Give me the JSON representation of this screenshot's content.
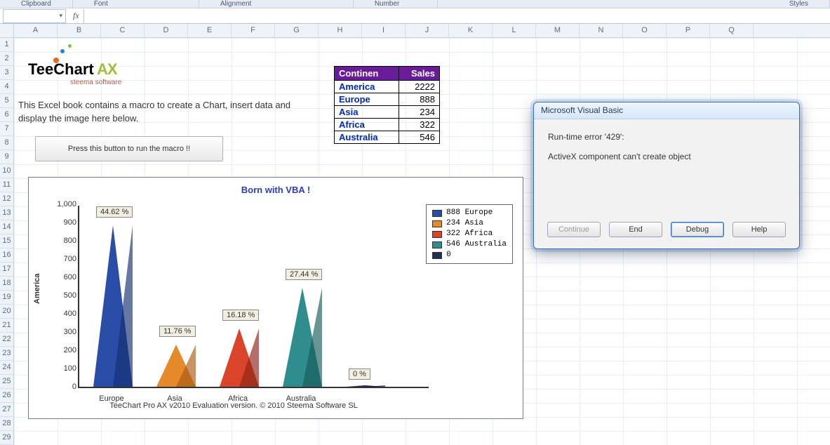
{
  "ribbon": {
    "groups": [
      "Clipboard",
      "Font",
      "Alignment",
      "Number",
      "Styles"
    ]
  },
  "nameBox": {
    "value": ""
  },
  "fxLabel": "fx",
  "formula": "",
  "columns": [
    "A",
    "B",
    "C",
    "D",
    "E",
    "F",
    "G",
    "H",
    "I",
    "J",
    "K",
    "L",
    "M",
    "N",
    "O",
    "P",
    "Q"
  ],
  "rowCount": 29,
  "logo": {
    "part1": "Tee",
    "part2": "Chart",
    "part3": " AX",
    "sub": "steema software"
  },
  "description": "This Excel book contains a macro to create a Chart, insert data and display the image here below.",
  "macroButton": "Press this button to run the macro !!",
  "table": {
    "headers": {
      "continent": "Continen",
      "sales": "Sales"
    },
    "rows": [
      {
        "region": "America",
        "value": "2222"
      },
      {
        "region": "Europe",
        "value": "888"
      },
      {
        "region": "Asia",
        "value": "234"
      },
      {
        "region": "Africa",
        "value": "322"
      },
      {
        "region": "Australia",
        "value": "546"
      }
    ]
  },
  "chart_data": {
    "type": "bar",
    "title": "Born with VBA !",
    "ylabel": "America",
    "ylim": [
      0,
      1000
    ],
    "yticks": [
      0,
      100,
      200,
      300,
      400,
      500,
      600,
      700,
      800,
      900,
      "1,000"
    ],
    "categories": [
      "Europe",
      "Asia",
      "Africa",
      "Australia",
      ""
    ],
    "series": [
      {
        "name": "888 Europe",
        "color": "#2a4da8"
      },
      {
        "name": "234 Asia",
        "color": "#e58a2a"
      },
      {
        "name": "322 Africa",
        "color": "#d9442a"
      },
      {
        "name": "546 Australia",
        "color": "#2f8d8d"
      },
      {
        "name": "0",
        "color": "#1e2e55"
      }
    ],
    "bars": [
      {
        "label": "Europe",
        "value": 888,
        "pct": "44.62 %",
        "color": "#2a4da8",
        "dark": "#14306e"
      },
      {
        "label": "Asia",
        "value": 234,
        "pct": "11.76 %",
        "color": "#e58a2a",
        "dark": "#a85a12"
      },
      {
        "label": "Africa",
        "value": 322,
        "pct": "16.18 %",
        "color": "#d9442a",
        "dark": "#8c2414"
      },
      {
        "label": "Australia",
        "value": 546,
        "pct": "27.44 %",
        "color": "#2f8d8d",
        "dark": "#185a5a"
      },
      {
        "label": "",
        "value": 0,
        "pct": "0 %",
        "color": "#1e2e55",
        "dark": "#0d1530"
      }
    ],
    "watermark": "TeeChart Pro AX v2010 Evaluation version. © 2010 Steema Software SL"
  },
  "dialog": {
    "title": "Microsoft Visual Basic",
    "line1": "Run-time error '429':",
    "line2": "ActiveX component can't create object",
    "buttons": {
      "continue": "Continue",
      "end": "End",
      "debug": "Debug",
      "help": "Help"
    }
  }
}
